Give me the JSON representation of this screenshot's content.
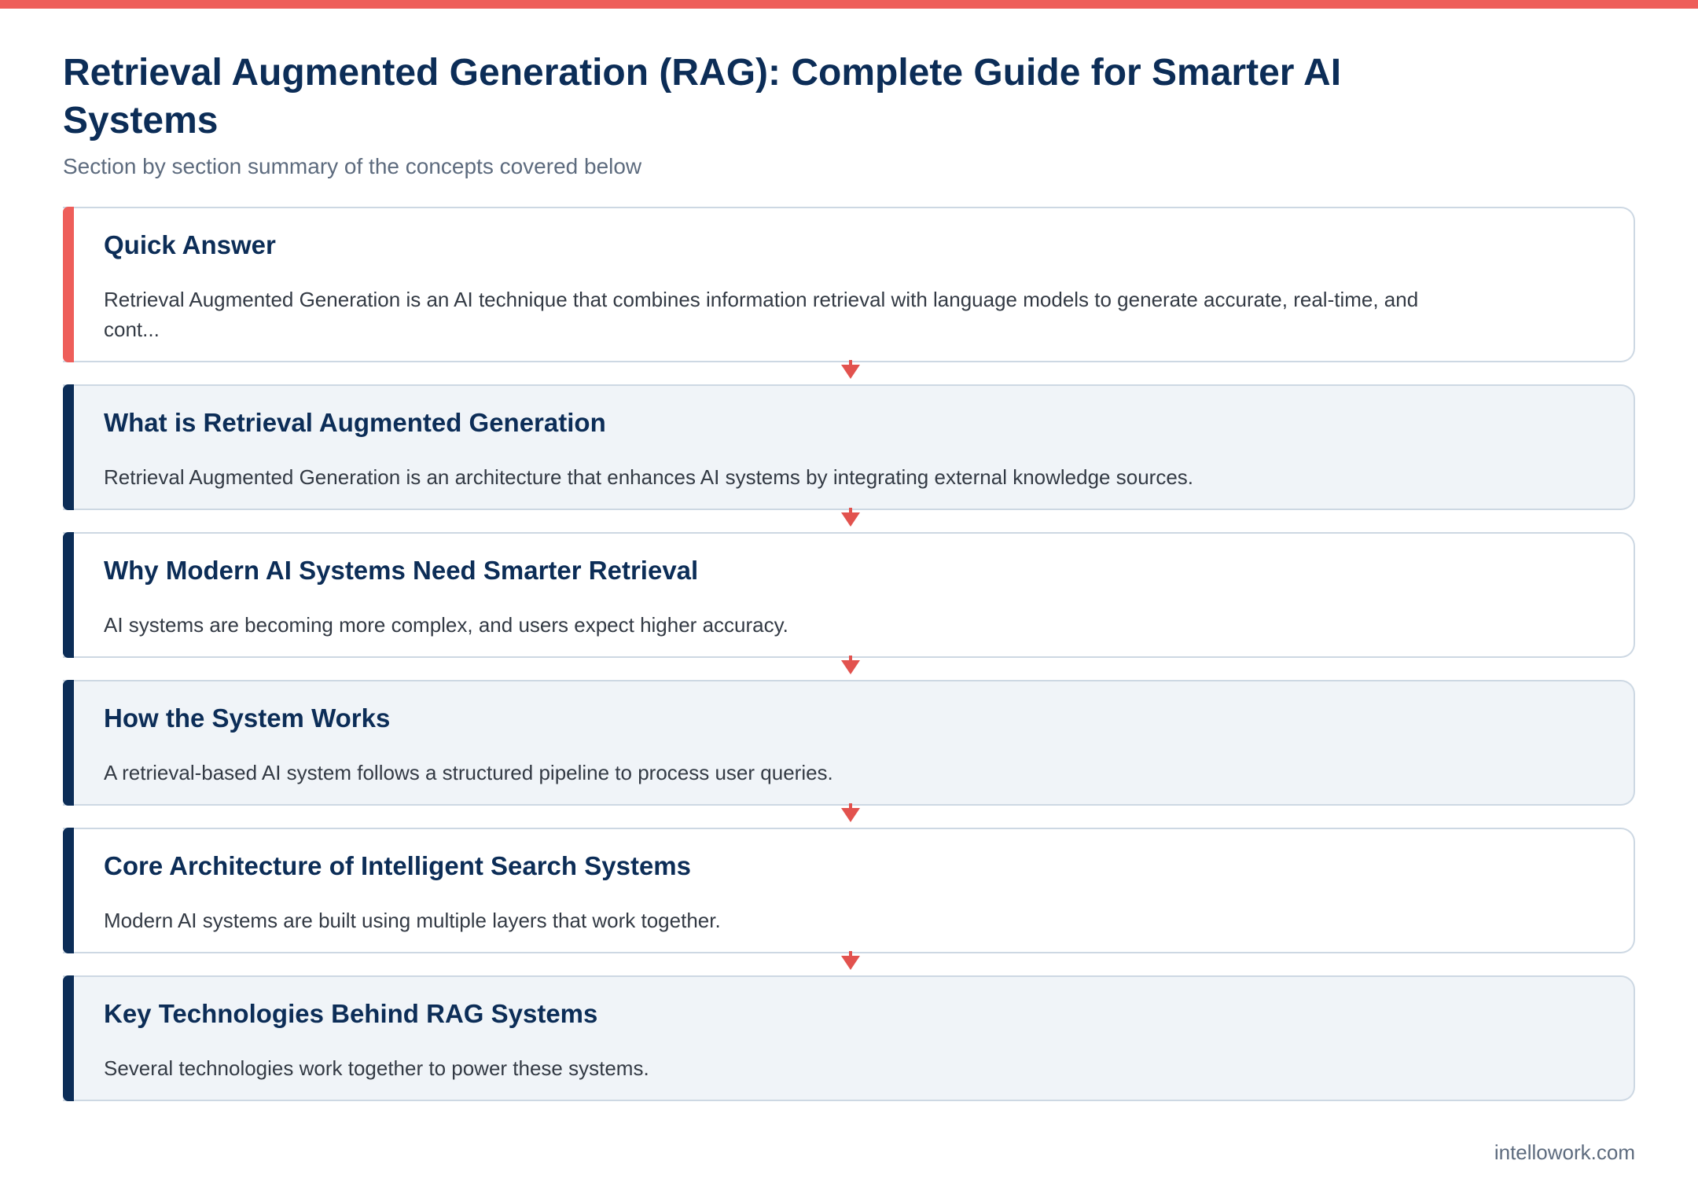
{
  "header": {
    "title": "Retrieval Augmented Generation (RAG): Complete Guide for Smarter AI Systems",
    "subtitle": "Section by section summary of the concepts covered below"
  },
  "sections": [
    {
      "title": "Quick Answer",
      "text": "Retrieval Augmented Generation is an AI technique that combines information retrieval with language models to generate accurate, real-time, and cont..."
    },
    {
      "title": "What is Retrieval Augmented Generation",
      "text": "Retrieval Augmented Generation is an architecture that enhances AI systems by integrating external knowledge sources."
    },
    {
      "title": "Why Modern AI Systems Need Smarter Retrieval",
      "text": "AI systems are becoming more complex, and users expect higher accuracy."
    },
    {
      "title": "How the System Works",
      "text": "A retrieval-based AI system follows a structured pipeline to process user queries."
    },
    {
      "title": "Core Architecture of Intelligent Search Systems",
      "text": "Modern AI systems are built using multiple layers that work together."
    },
    {
      "title": "Key Technologies Behind RAG Systems",
      "text": "Several technologies work together to power these systems."
    }
  ],
  "footer": {
    "source": "intellowork.com"
  },
  "colors": {
    "accent_red": "#ee5e5a",
    "navy": "#0c2d57",
    "card_alt_bg": "#f0f4f8",
    "border": "#cdd8e3"
  },
  "icons": {
    "connector": "down-arrow-icon"
  }
}
